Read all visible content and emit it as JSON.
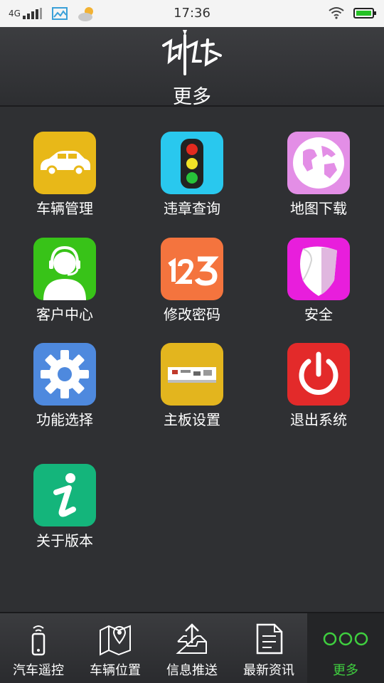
{
  "status_bar": {
    "network": "4G",
    "time": "17:36",
    "icons": [
      "signal-bars-icon",
      "image-icon",
      "weather-icon",
      "wifi-icon",
      "battery-icon"
    ]
  },
  "header": {
    "logo_icon": "brand-logo",
    "title": "更多"
  },
  "menu": {
    "items": [
      {
        "label": "车辆管理",
        "icon": "car-icon",
        "color": "#e8b818"
      },
      {
        "label": "违章查询",
        "icon": "traffic-light-icon",
        "color": "#29c8ee"
      },
      {
        "label": "地图下载",
        "icon": "globe-icon",
        "color": "#e38ee6"
      },
      {
        "label": "客户中心",
        "icon": "customer-service-icon",
        "color": "#38c318"
      },
      {
        "label": "修改密码",
        "icon": "numeric-123-icon",
        "color": "#f4743e"
      },
      {
        "label": "安全",
        "icon": "shield-icon",
        "color": "#e81edc"
      },
      {
        "label": "功能选择",
        "icon": "gear-icon",
        "color": "#4e89de"
      },
      {
        "label": "主板设置",
        "icon": "circuit-board-icon",
        "color": "#e3b51e"
      },
      {
        "label": "退出系统",
        "icon": "power-icon",
        "color": "#e32a2a"
      },
      {
        "label": "关于版本",
        "icon": "info-icon",
        "color": "#14b57b"
      }
    ]
  },
  "bottom_nav": {
    "items": [
      {
        "label": "汽车遥控",
        "icon": "remote-control-icon",
        "active": false
      },
      {
        "label": "车辆位置",
        "icon": "map-location-icon",
        "active": false
      },
      {
        "label": "信息推送",
        "icon": "upload-tray-icon",
        "active": false
      },
      {
        "label": "最新资讯",
        "icon": "document-icon",
        "active": false
      },
      {
        "label": "更多",
        "icon": "three-circles-icon",
        "active": true
      }
    ],
    "active_color": "#3fcf3f"
  }
}
